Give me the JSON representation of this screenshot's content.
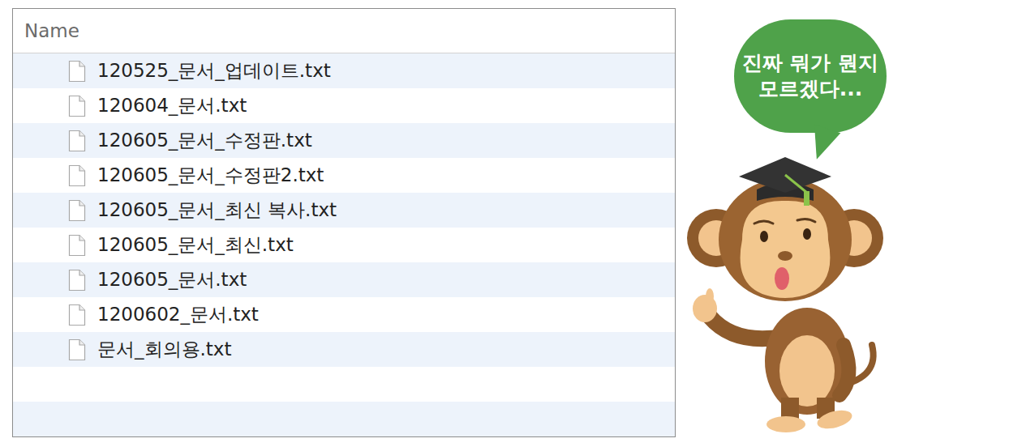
{
  "file_list": {
    "columns": [
      "Name"
    ],
    "files": [
      "120525_문서_업데이트.txt",
      "120604_문서.txt",
      "120605_문서_수정판.txt",
      "120605_문서_수정판2.txt",
      "120605_문서_최신 복사.txt",
      "120605_문서_최신.txt",
      "120605_문서.txt",
      "1200602_문서.txt",
      "문서_회의용.txt"
    ]
  },
  "speech_bubble": {
    "lines": [
      "진짜 뭐가 뭔지",
      "모르겠다..."
    ]
  }
}
